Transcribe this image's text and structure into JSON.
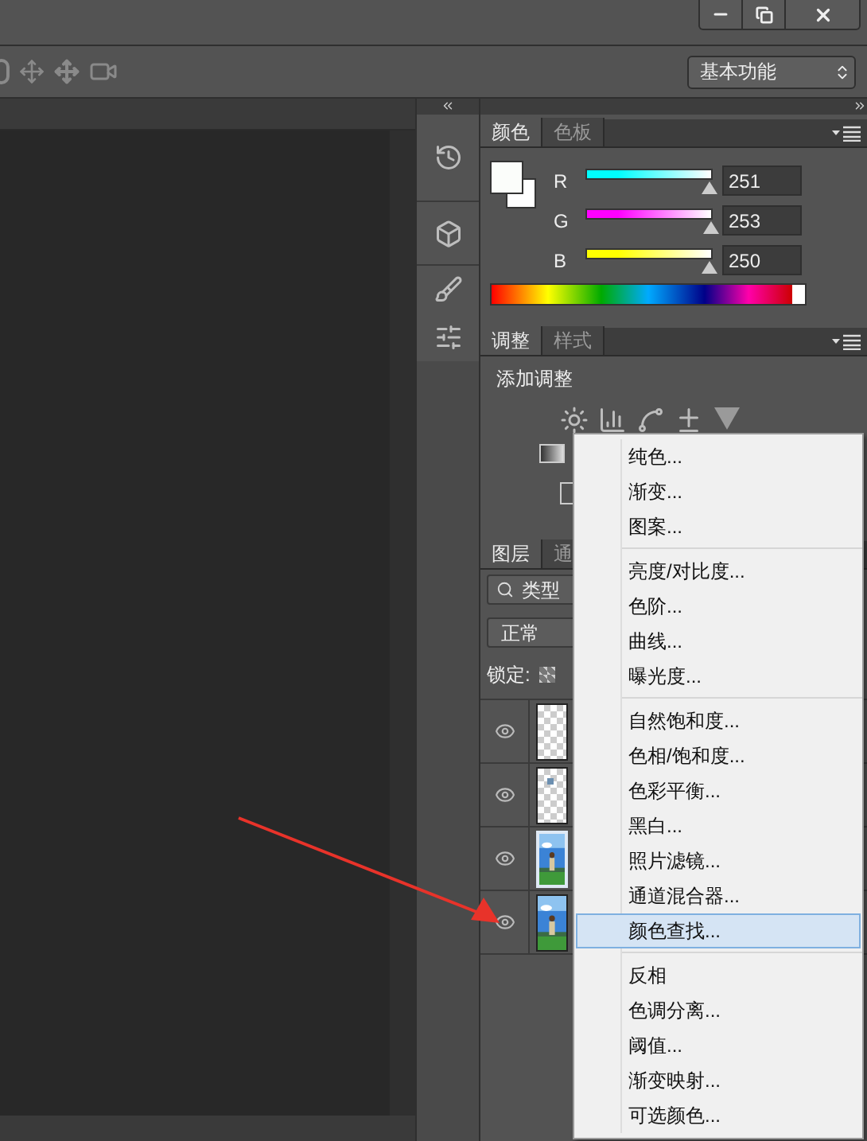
{
  "workspace": {
    "value": "基本功能"
  },
  "color_panel": {
    "tabs": [
      {
        "label": "颜色",
        "selected": true
      },
      {
        "label": "色板",
        "selected": false
      }
    ],
    "channels": [
      {
        "name": "R",
        "level": 0.98,
        "value": "251",
        "color": "#00ffff"
      },
      {
        "name": "G",
        "level": 0.99,
        "value": "253",
        "color": "#ff00ff"
      },
      {
        "name": "B",
        "level": 0.98,
        "value": "250",
        "color": "#ffff00"
      }
    ]
  },
  "adjustments_panel": {
    "tabs": [
      {
        "label": "调整",
        "selected": true
      },
      {
        "label": "样式",
        "selected": false
      }
    ],
    "heading": "添加调整"
  },
  "layers_panel": {
    "tabs": [
      {
        "label": "图层",
        "selected": true
      },
      {
        "label": "通",
        "selected": false
      }
    ],
    "filter": "类型",
    "blend_mode": "正常",
    "lock_label": "锁定:",
    "layers": [
      {
        "visible": true,
        "kind": "transparent",
        "selected": false
      },
      {
        "visible": true,
        "kind": "transparent_mark",
        "selected": false
      },
      {
        "visible": true,
        "kind": "picture",
        "selected": true
      },
      {
        "visible": true,
        "kind": "picture",
        "selected": false
      }
    ]
  },
  "context_menu": {
    "groups": [
      [
        {
          "label": "纯色...",
          "selected": false
        },
        {
          "label": "渐变...",
          "selected": false
        },
        {
          "label": "图案...",
          "selected": false
        }
      ],
      [
        {
          "label": "亮度/对比度...",
          "selected": false
        },
        {
          "label": "色阶...",
          "selected": false
        },
        {
          "label": "曲线...",
          "selected": false
        },
        {
          "label": "曝光度...",
          "selected": false
        }
      ],
      [
        {
          "label": "自然饱和度...",
          "selected": false
        },
        {
          "label": "色相/饱和度...",
          "selected": false
        },
        {
          "label": "色彩平衡...",
          "selected": false
        },
        {
          "label": "黑白...",
          "selected": false
        },
        {
          "label": "照片滤镜...",
          "selected": false
        },
        {
          "label": "通道混合器...",
          "selected": false
        },
        {
          "label": "颜色查找...",
          "selected": true
        }
      ],
      [
        {
          "label": "反相",
          "selected": false
        },
        {
          "label": "色调分离...",
          "selected": false
        },
        {
          "label": "阈值...",
          "selected": false
        },
        {
          "label": "渐变映射...",
          "selected": false
        },
        {
          "label": "可选颜色...",
          "selected": false
        }
      ]
    ]
  }
}
